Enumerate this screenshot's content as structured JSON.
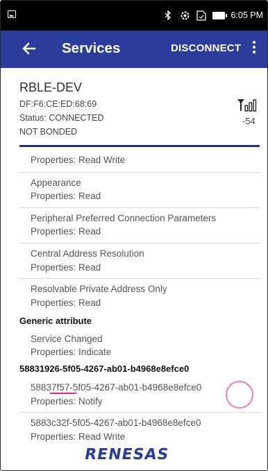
{
  "status_bar": {
    "time": "6:05 PM",
    "icons": [
      "image-icon",
      "bluetooth-icon",
      "sync-icon",
      "screenshot-icon",
      "battery-icon"
    ]
  },
  "app_bar": {
    "title": "Services",
    "action": "DISCONNECT",
    "color": "#2b3d9b"
  },
  "device": {
    "name": "RBLE-DEV",
    "address": "DF:F6:CE:ED:68:69",
    "status": "Status:  CONNECTED",
    "bond": "NOT BONDED",
    "rssi": "-54"
  },
  "items": [
    {
      "name": "",
      "properties": "Properties: Read Write"
    },
    {
      "name": "Appearance",
      "properties": "Properties: Read"
    },
    {
      "name": "Peripheral Preferred Connection Parameters",
      "properties": "Properties: Read"
    },
    {
      "name": "Central Address Resolution",
      "properties": "Properties: Read"
    },
    {
      "name": "Resolvable Private Address Only",
      "properties": "Properties: Read"
    }
  ],
  "generic_attribute": {
    "header": "Generic attribute",
    "characteristic": "Service Changed",
    "properties": "Properties: Indicate"
  },
  "custom_service": {
    "header": "58831926-5f05-4267-ab01-b4968e8efce0",
    "char1_prefix": "5883",
    "char1_marked": "7f57",
    "char1_rest": "-5f05-4267-ab01-b4968e8efce0",
    "char1_properties": "Properties: Notify",
    "char2_uuid": "5883c32f-5f05-4267-ab01-b4968e8efce0",
    "char2_properties": "Properties: Read Write"
  },
  "logo_text": "RENESAS"
}
